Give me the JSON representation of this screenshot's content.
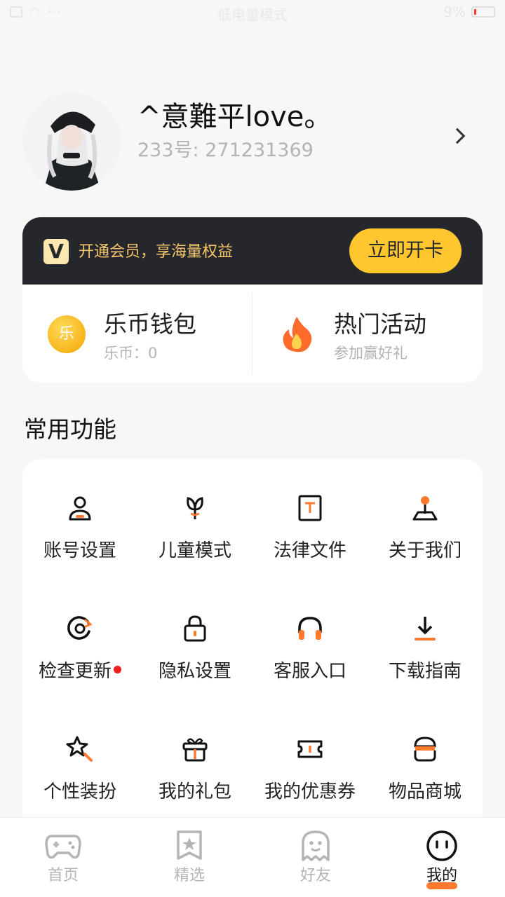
{
  "status_bar": {
    "center_text": "低电量模式",
    "battery_text": "9%",
    "signal_icon": "wifi-icon"
  },
  "profile": {
    "username": "^意難平love。",
    "user_id": "233号: 271231369"
  },
  "membership": {
    "logo_letter": "V",
    "promo_text": "开通会员，享海量权益",
    "button_label": "立即开卡",
    "accent_color": "#ffc62e",
    "banner_color": "#26262d"
  },
  "wallet": {
    "coin_glyph": "乐",
    "title": "乐币钱包",
    "subtitle": "乐币：0"
  },
  "activities": {
    "title": "热门活动",
    "subtitle": "参加赢好礼"
  },
  "features": {
    "section_title": "常用功能",
    "items": [
      {
        "label": "账号设置",
        "icon": "user-icon"
      },
      {
        "label": "儿童模式",
        "icon": "sprout-icon"
      },
      {
        "label": "法律文件",
        "icon": "document-icon"
      },
      {
        "label": "关于我们",
        "icon": "location-pin-icon"
      },
      {
        "label": "检查更新",
        "icon": "refresh-icon"
      },
      {
        "label": "隐私设置",
        "icon": "lock-icon"
      },
      {
        "label": "客服入口",
        "icon": "headset-icon"
      },
      {
        "label": "下载指南",
        "icon": "download-icon"
      },
      {
        "label": "个性装扮",
        "icon": "magic-wand-icon"
      },
      {
        "label": "我的礼包",
        "icon": "gift-icon"
      },
      {
        "label": "我的优惠券",
        "icon": "coupon-icon"
      },
      {
        "label": "物品商城",
        "icon": "store-icon"
      }
    ]
  },
  "tab_bar": {
    "tabs": [
      {
        "label": "首页",
        "icon": "gamepad-icon"
      },
      {
        "label": "精选",
        "icon": "star-bookmark-icon"
      },
      {
        "label": "好友",
        "icon": "ghost-icon"
      },
      {
        "label": "我的",
        "icon": "face-icon"
      }
    ],
    "active_color": "#ff7a2f"
  }
}
